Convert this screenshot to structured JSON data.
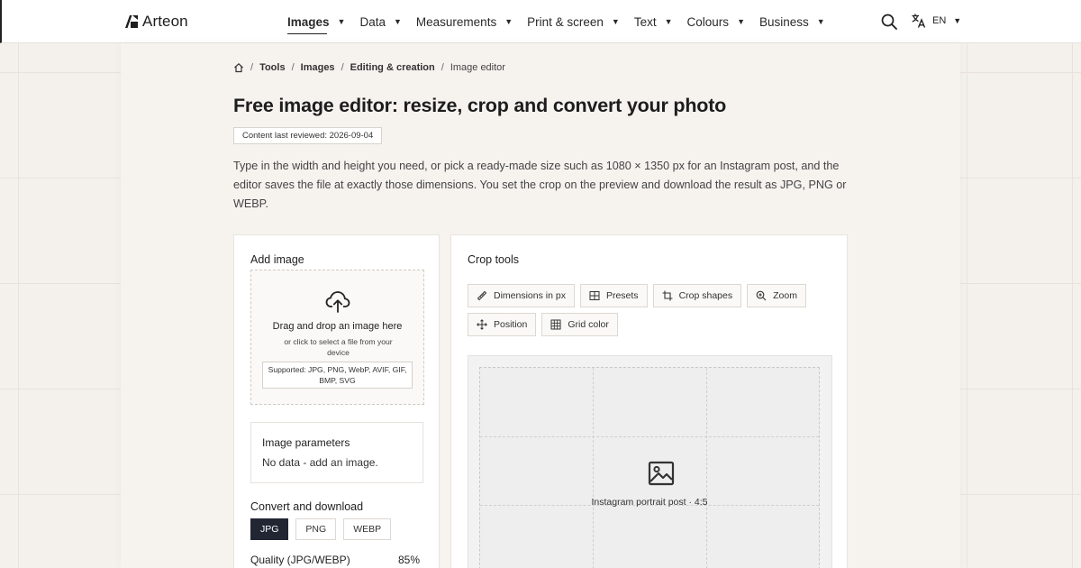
{
  "brand": {
    "name": "Arteon"
  },
  "nav": {
    "items": [
      {
        "label": "Images",
        "active": true
      },
      {
        "label": "Data"
      },
      {
        "label": "Measurements"
      },
      {
        "label": "Print & screen"
      },
      {
        "label": "Text"
      },
      {
        "label": "Colours"
      },
      {
        "label": "Business"
      }
    ],
    "lang": "EN"
  },
  "breadcrumb": {
    "items": [
      "Tools",
      "Images",
      "Editing & creation"
    ],
    "current": "Image editor"
  },
  "page": {
    "title": "Free image editor: resize, crop and convert your photo",
    "reviewed_label": "Content last reviewed:",
    "reviewed_date": "2026-09-04",
    "intro": "Type in the width and height you need, or pick a ready-made size such as 1080 × 1350 px for an Instagram post, and the editor saves the file at exactly those dimensions. You set the crop on the preview and download the result as JPG, PNG or WEBP."
  },
  "add_image": {
    "title": "Add image",
    "drop_main": "Drag and drop an image here",
    "drop_sub": "or click to select a file from your device",
    "supported": "Supported: JPG, PNG, WebP, AVIF, GIF, BMP, SVG"
  },
  "params": {
    "title": "Image parameters",
    "value": "No data - add an image."
  },
  "convert": {
    "title": "Convert and download",
    "formats": [
      "JPG",
      "PNG",
      "WEBP"
    ],
    "selected": "JPG",
    "quality_label": "Quality (JPG/WEBP)",
    "quality_value": "85%"
  },
  "crop": {
    "title": "Crop tools",
    "tools": [
      {
        "label": "Dimensions in px",
        "icon": "ruler-icon"
      },
      {
        "label": "Presets",
        "icon": "grid-icon"
      },
      {
        "label": "Crop shapes",
        "icon": "crop-icon"
      },
      {
        "label": "Zoom",
        "icon": "zoom-icon"
      },
      {
        "label": "Position",
        "icon": "move-icon"
      },
      {
        "label": "Grid color",
        "icon": "grid-color-icon"
      }
    ],
    "preview_label": "Instagram portrait post · 4:5"
  },
  "colors": {
    "accent": "#222633",
    "background": "#f4f1ed",
    "text": "#222222"
  }
}
